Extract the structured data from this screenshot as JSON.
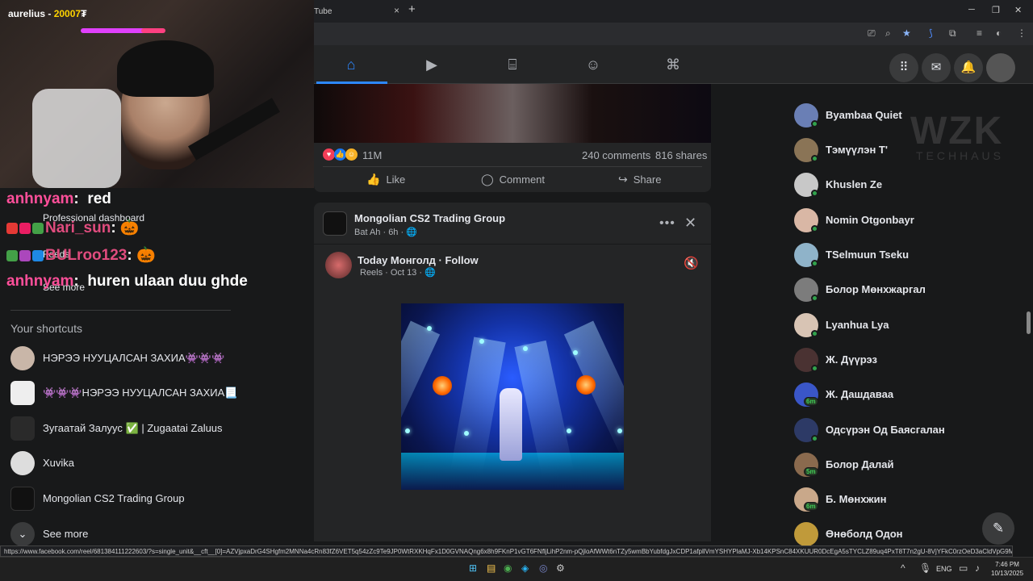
{
  "stream": {
    "streamer": "aurelius",
    "amount": "20007"
  },
  "browser": {
    "tab_title": "Tube",
    "tab_close": "×",
    "new_tab": "+",
    "win_min": "─",
    "win_max": "❐",
    "win_close": "✕"
  },
  "chat": [
    {
      "user": "anhnyam",
      "message": "red"
    },
    {
      "user": "Nari_sun",
      "message": "🎃"
    },
    {
      "user": "BULroo123",
      "message": "🎃"
    },
    {
      "user": "anhnyam",
      "message": "huren ulaan duu ghde"
    }
  ],
  "left_nav": {
    "professional_dashboard": "Professional dashboard",
    "feeds": "Feeds",
    "see_more_top": "See more",
    "shortcuts_title": "Your shortcuts",
    "shortcuts": [
      {
        "label": "НЭРЭЭ НУУЦАЛСАН ЗАХИА👾👾👾"
      },
      {
        "label": "👾👾👾НЭРЭЭ НУУЦАЛСАН ЗАХИА📃"
      },
      {
        "label": "Зугаатай Залуус ✅ | Zugaatai Zaluus"
      },
      {
        "label": "Xuvika"
      },
      {
        "label": "Mongolian CS2 Trading Group"
      }
    ],
    "see_more": "See more"
  },
  "post1": {
    "likes": "11M",
    "comments": "240 comments",
    "shares": "816 shares",
    "like": "Like",
    "comment": "Comment",
    "share": "Share"
  },
  "post2": {
    "group_name": "Mongolian CS2 Trading Group",
    "group_meta": "Bat Ah · 6h · 🌐",
    "page_name": "Today Монголд · Follow",
    "page_meta": "Reels · Oct 13 · 🌐"
  },
  "contacts": [
    {
      "name": "Byambaa Quiet",
      "status": "online",
      "color": "#6a7fb5"
    },
    {
      "name": "Тэмүүлэн Т'",
      "status": "online",
      "color": "#8a7456"
    },
    {
      "name": "Khuslen Ze",
      "status": "online",
      "color": "#c8c8c8"
    },
    {
      "name": "Nomin Otgonbayr",
      "status": "online",
      "color": "#d9b7a5"
    },
    {
      "name": "TSelmuun Tseku",
      "status": "online",
      "color": "#8fb3c9"
    },
    {
      "name": "Болор Мөнхжаргал",
      "status": "online",
      "color": "#7c7c7c"
    },
    {
      "name": "Lyanhua Lya",
      "status": "online",
      "color": "#d8c4b4"
    },
    {
      "name": "Ж. Дүүрэз",
      "status": "online",
      "color": "#4a3232"
    },
    {
      "name": "Ж. Дашдаваа",
      "status": "6m",
      "color": "#3a56c8"
    },
    {
      "name": "Одсүрэн Од Баясгалан",
      "status": "online",
      "color": "#2d3a66"
    },
    {
      "name": "Болор Далай",
      "status": "5m",
      "color": "#8a6a4e"
    },
    {
      "name": "Б. Мөнхжин",
      "status": "6m",
      "color": "#c9a88a"
    },
    {
      "name": "Өнөболд Одон",
      "status": "",
      "color": "#c09a3a"
    }
  ],
  "watermark": {
    "main": "WZK",
    "sub": "TECHHAUS"
  },
  "status_url": "https://www.facebook.com/reel/681384111222603/?s=single_unit&__cft__[0]=AZVjpxaDrG4SHgfm2MNNa4cRn83fZ6VET5q54zZc9Te9JP0WtRXKHqFx1D0GVNAQng6x8h9FKnP1vGT6FNfljLihP2nm-pQjloAfWWt6nTZy5wmBbYubfdgJxCDP1afpllVmYSHYPlaMJ-Xb14KPSnC84XKUUR0DcEgA5sTYCLZ89uq4PxT8T7n2gU-8VjYFkC0rzOeD3aCldVpG9MN2A0-I6Bg...",
  "taskbar": {
    "lang": "ENG",
    "time": "7:46 PM",
    "date": "10/13/2025"
  }
}
